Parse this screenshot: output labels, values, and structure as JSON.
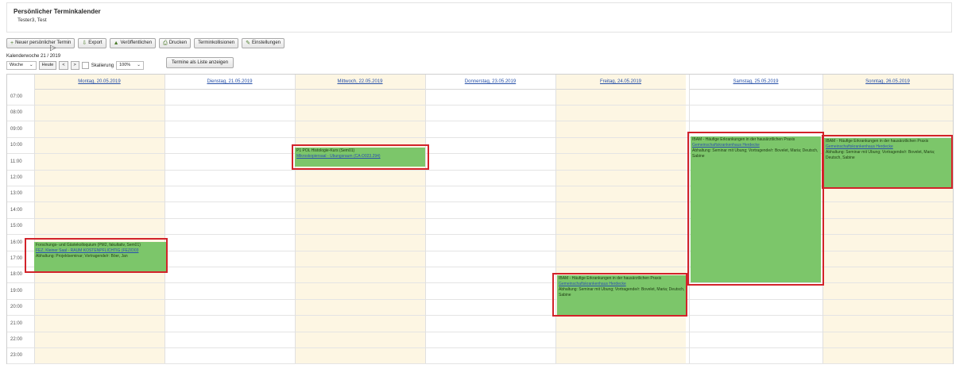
{
  "header": {
    "title": "Persönlicher Terminkalender",
    "user": "Tester3, Test"
  },
  "toolbar": {
    "new": "Neuer persönlicher Termin",
    "export": "Export",
    "publish": "Veröffentlichen",
    "print": "Drucken",
    "collisions": "Terminkollisionen",
    "settings": "Einstellungen"
  },
  "week_label": "Kalenderwoche 21 / 2019",
  "controls": {
    "view": "Woche",
    "today": "Heute",
    "prev": "<",
    "next": ">",
    "scale_label": "Skalierung",
    "scale_value": "100%"
  },
  "list_button": "Termine als Liste anzeigen",
  "days": [
    "Montag, 20.05.2019",
    "Dienstag, 21.05.2019",
    "Mittwoch, 22.05.2019",
    "Donnerstag, 23.05.2019",
    "Freitag, 24.05.2019",
    "Samstag, 25.05.2019",
    "Sonntag, 26.05.2019"
  ],
  "hours": [
    "07:00",
    "08:00",
    "09:00",
    "10:00",
    "11:00",
    "12:00",
    "13:00",
    "14:00",
    "15:00",
    "16:00",
    "17:00",
    "18:00",
    "19:00",
    "20:00",
    "21:00",
    "22:00",
    "23:00"
  ],
  "events": {
    "mon": {
      "title": "Forschungs- und Gästekolloquium (PM2, fakultativ, Sem01)",
      "room": "FEZ, Kleiner Saal - RAUM KOSTENPFLICHTIG (FEZ/D03",
      "details": "Abhaltung: Projektseminar; Vortragende/r: Böer, Jan"
    },
    "wed": {
      "title": "P1 POL Histologie-Kurs (Sem01)",
      "room": "Mikroskopiersaal - Übungsraum (CA-D023.294)"
    },
    "fri": {
      "title": "IBAM - Häufige Erkrankungen in der hausärztlichen Praxis",
      "room": "Gemeinschaftskrankenhaus Herdecke",
      "details": "Abhaltung: Seminar mit Übung; Vortragende/r: Bovelet, Maria; Deutsch, Sabine"
    },
    "sat": {
      "title": "IBAM - Häufige Erkrankungen in der hausärztlichen Praxis",
      "room": "Gemeinschaftskrankenhaus Herdecke",
      "details": "Abhaltung: Seminar mit Übung; Vortragende/r: Bovelet, Maria; Deutsch, Sabine"
    },
    "sun": {
      "title": "IBAM - Häufige Erkrankungen in der hausärztlichen Praxis",
      "room": "Gemeinschaftskrankenhaus Herdecke",
      "details": "Abhaltung: Seminar mit Übung; Vortragende/r: Bovelet, Maria; Deutsch, Sabine"
    }
  },
  "colors": {
    "event_green": "#7cc66a",
    "highlight_red": "#d2232a",
    "weekend_bg": "#fdf6e3",
    "link_blue": "#2650a8"
  }
}
